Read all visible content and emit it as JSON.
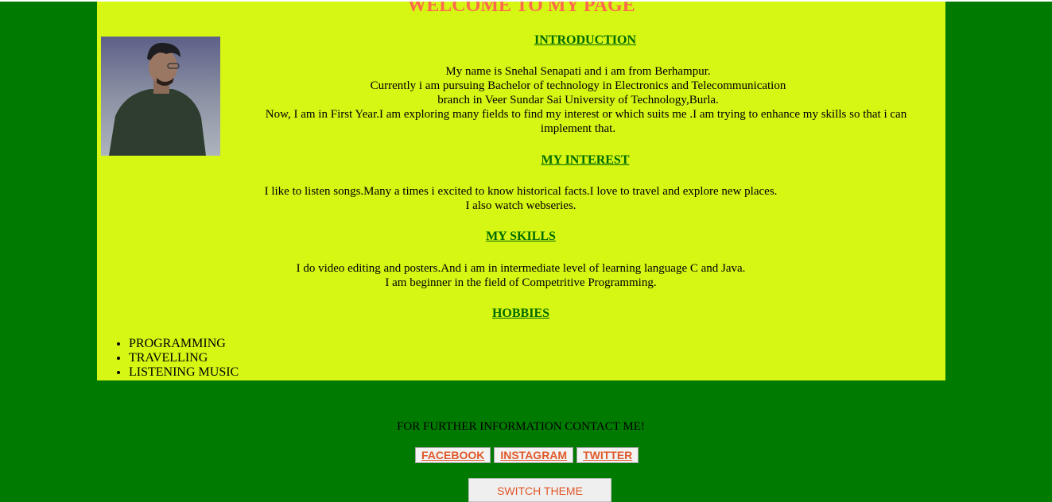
{
  "header": {
    "title": "WELCOME TO MY PAGE"
  },
  "profile": {
    "photo_icon": "profile-photo"
  },
  "introduction": {
    "title": "INTRODUCTION",
    "lines": [
      "My name is Snehal Senapati and i am from Berhampur.",
      "Currently i am pursuing Bachelor of technology in Electronics and Telecommunication",
      "branch in Veer Sundar Sai University of Technology,Burla.",
      "Now, I am in First Year.I am exploring many fields to find my interest or which suits me .I am trying to enhance my skills so that i can",
      "implement that."
    ]
  },
  "interest": {
    "title": "MY INTEREST",
    "lines": [
      "I like to listen songs.Many a times i excited to know historical facts.I love to travel and explore new places.",
      "I also watch webseries."
    ]
  },
  "skills": {
    "title": "MY SKILLS",
    "lines": [
      "I do video editing and posters.And i am in intermediate level of learning language C and Java.",
      "I am beginner in the field of Competritive Programming."
    ]
  },
  "hobbies": {
    "title": "HOBBIES",
    "items": [
      "PROGRAMMING",
      "TRAVELLING",
      "LISTENING MUSIC"
    ]
  },
  "contact": {
    "text": "FOR FURTHER INFORMATION CONTACT ME!",
    "links": [
      "FACEBOOK",
      "INSTAGRAM",
      "TWITTER"
    ]
  },
  "theme": {
    "button_label": "SWITCH THEME"
  },
  "colors": {
    "page_background": "#007a00",
    "panel_background": "#d6f614",
    "heading": "#ff6a4d",
    "section_title": "#006b00",
    "link": "#e0592a"
  }
}
